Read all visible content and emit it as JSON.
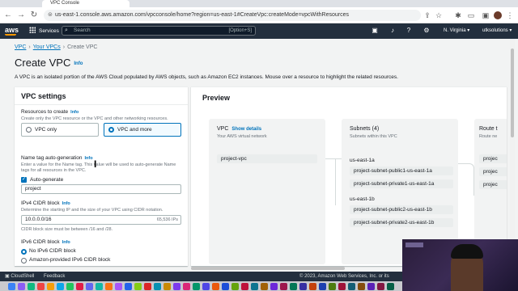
{
  "browser": {
    "tab_title": "VPC Console",
    "url": "us-east-1.console.aws.amazon.com/vpcconsole/home?region=us-east-1#CreateVpc:createMode=vpcWithResources"
  },
  "aws_nav": {
    "logo": "aws",
    "services": "Services",
    "search_placeholder": "Search",
    "search_shortcut": "[Option+S]",
    "region": "N. Virginia",
    "account": "utksolutions"
  },
  "breadcrumb": [
    "VPC",
    "Your VPCs",
    "Create VPC"
  ],
  "page": {
    "title": "Create VPC",
    "title_info": "Info",
    "description": "A VPC is an isolated portion of the AWS Cloud populated by AWS objects, such as Amazon EC2 instances. Mouse over a resource to highlight the related resources."
  },
  "settings": {
    "header": "VPC settings",
    "resources_label": "Resources to create",
    "info": "Info",
    "resources_desc": "Create only the VPC resource or the VPC and other networking resources.",
    "option_vpc_only": "VPC only",
    "option_vpc_more": "VPC and more",
    "name_tag_label": "Name tag auto-generation",
    "name_tag_desc": "Enter a value for the Name tag. This value will be used to auto-generate Name tags for all resources in the VPC.",
    "auto_generate": "Auto-generate",
    "name_value": "project",
    "ipv4_label": "IPv4 CIDR block",
    "ipv4_desc": "Determine the starting IP and the size of your VPC using CIDR notation.",
    "ipv4_value": "10.0.0.0/16",
    "ipv4_count": "65,536 IPs",
    "ipv4_hint": "CIDR block size must be between /16 and /28.",
    "ipv6_label": "IPv6 CIDR block",
    "ipv6_none": "No IPv6 CIDR block",
    "ipv6_amazon": "Amazon-provided IPv6 CIDR block"
  },
  "preview": {
    "title": "Preview",
    "vpc": {
      "heading": "VPC",
      "link": "Show details",
      "sub": "Your AWS virtual network",
      "item": "project-vpc"
    },
    "subnets": {
      "heading": "Subnets (4)",
      "sub": "Subnets within this VPC",
      "az1": "us-east-1a",
      "az1_items": [
        "project-subnet-public1-us-east-1a",
        "project-subnet-private1-us-east-1a"
      ],
      "az2": "us-east-1b",
      "az2_items": [
        "project-subnet-public2-us-east-1b",
        "project-subnet-private2-us-east-1b"
      ]
    },
    "route": {
      "heading": "Route t",
      "sub": "Route ne",
      "items": [
        "projec",
        "projec",
        "projec"
      ]
    }
  },
  "footer": {
    "cloudshell": "CloudShell",
    "feedback": "Feedback",
    "copyright": "© 2023, Amazon Web Services, Inc. or its"
  },
  "colors": {
    "aws_nav": "#232f3e",
    "link": "#0073bb",
    "accent": "#ff9900"
  }
}
